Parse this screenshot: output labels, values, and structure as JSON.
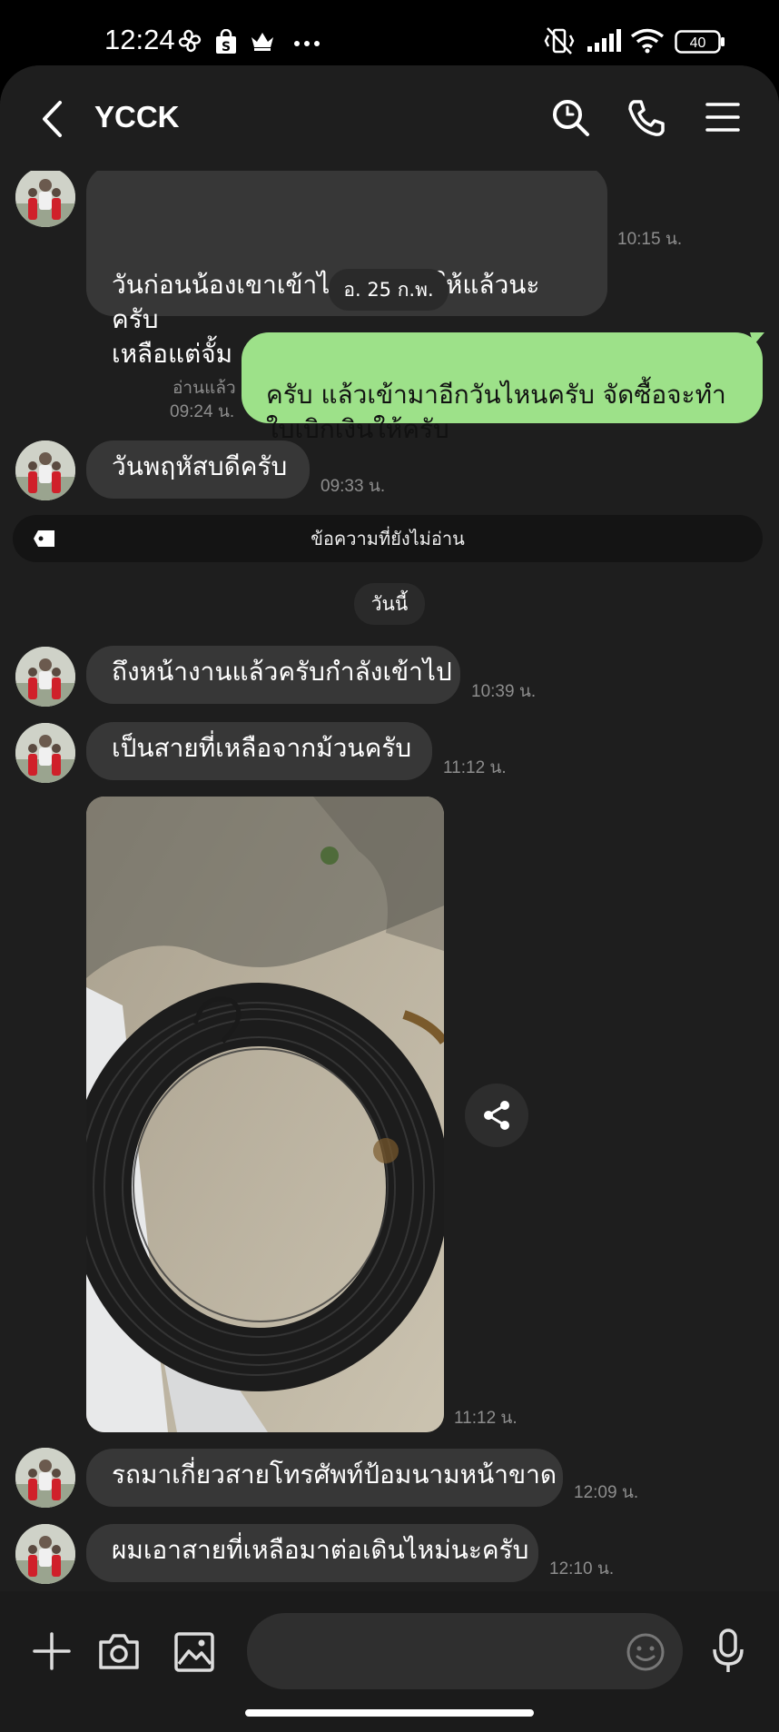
{
  "status": {
    "time": "12:24",
    "battery": "40"
  },
  "header": {
    "title": "YCCK"
  },
  "messages": [
    {
      "text": "วันก่อนน้องเขาเข้าไปเดินสายให้แล้วนะครับ\nเหลือแต่จั้ม",
      "time": "10:15 น."
    },
    {
      "date": "อ. 25 ก.พ."
    },
    {
      "text": "ครับ แล้วเข้ามาอีกวันไหนครับ จัดซื้อจะทำ\nใบเบิกเงินให้ครับ",
      "read": "อ่านแล้ว",
      "time": "09:24 น."
    },
    {
      "text": "วันพฤหัสบดีครับ",
      "time": "09:33 น."
    },
    {
      "unread_label": "ข้อความที่ยังไม่อ่าน"
    },
    {
      "date": "วันนี้"
    },
    {
      "text": "ถึงหน้างานแล้วครับกำลังเข้าไป",
      "time": "10:39 น."
    },
    {
      "text": "เป็นสายที่เหลือจากม้วนครับ",
      "time": "11:12 น."
    },
    {
      "time": "11:12 น."
    },
    {
      "text": "รถมาเกี่ยวสายโทรศัพท์ป้อมนามหน้าขาด",
      "time": "12:09 น."
    },
    {
      "text": "ผมเอาสายที่เหลือมาต่อเดินไหม่นะครับ",
      "time": "12:10 น."
    }
  ],
  "icons": {
    "status": [
      "pinwheel-icon",
      "shopping-bag-icon",
      "crown-icon",
      "more-dots-icon",
      "mute-icon",
      "signal-icon",
      "wifi-icon",
      "battery-icon"
    ],
    "header": [
      "back-icon",
      "search-icon",
      "phone-icon",
      "menu-icon"
    ],
    "photo": "share-icon",
    "input": [
      "plus-icon",
      "camera-icon",
      "image-icon",
      "emoji-icon",
      "microphone-icon"
    ]
  },
  "colors": {
    "background": "#1e1e1e",
    "incoming_bubble": "#373737",
    "outgoing_bubble": "#9de189",
    "time_text": "#8d8d8d"
  }
}
